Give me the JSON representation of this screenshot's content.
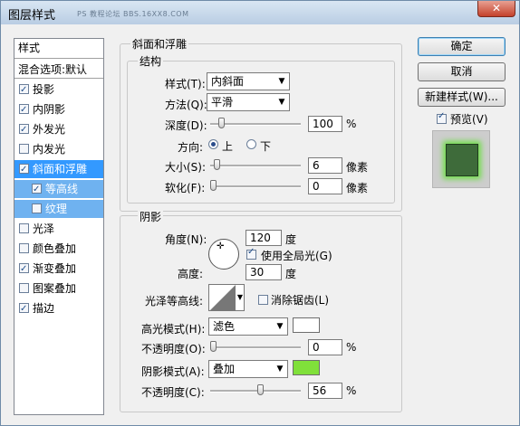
{
  "window": {
    "title": "图层样式",
    "watermark": "PS 教程论坛 BBS.16XX8.COM",
    "close_icon": "close-icon"
  },
  "styles_list": {
    "header": "样式",
    "blend_options": "混合选项:默认",
    "items": [
      {
        "label": "投影",
        "checked": true
      },
      {
        "label": "内阴影",
        "checked": true
      },
      {
        "label": "外发光",
        "checked": true
      },
      {
        "label": "内发光",
        "checked": false
      },
      {
        "label": "斜面和浮雕",
        "checked": true,
        "selected": true
      },
      {
        "label": "等高线",
        "checked": true,
        "sub": true
      },
      {
        "label": "纹理",
        "checked": false,
        "sub": true
      },
      {
        "label": "光泽",
        "checked": false
      },
      {
        "label": "颜色叠加",
        "checked": false
      },
      {
        "label": "渐变叠加",
        "checked": true
      },
      {
        "label": "图案叠加",
        "checked": false
      },
      {
        "label": "描边",
        "checked": true
      }
    ]
  },
  "bevel": {
    "section_title": "斜面和浮雕",
    "structure_title": "结构",
    "style_label": "样式(T):",
    "style_value": "内斜面",
    "technique_label": "方法(Q):",
    "technique_value": "平滑",
    "depth_label": "深度(D):",
    "depth_value": "100",
    "depth_unit": "%",
    "depth_level": 0.1,
    "direction_label": "方向:",
    "dir_up": "上",
    "dir_down": "下",
    "direction": "up",
    "size_label": "大小(S):",
    "size_value": "6",
    "size_unit": "像素",
    "size_level": 0.04,
    "soften_label": "软化(F):",
    "soften_value": "0",
    "soften_unit": "像素",
    "soften_level": 0
  },
  "shading": {
    "title": "阴影",
    "angle_label": "角度(N):",
    "angle_value": "120",
    "angle_unit": "度",
    "global_light": "使用全局光(G)",
    "global_light_checked": true,
    "altitude_label": "高度:",
    "altitude_value": "30",
    "altitude_unit": "度",
    "gloss_label": "光泽等高线:",
    "antialias": "消除锯齿(L)",
    "antialias_checked": false,
    "highlight_mode_label": "高光模式(H):",
    "highlight_mode": "滤色",
    "highlight_color": "#ffffff",
    "highlight_opacity_label": "不透明度(O):",
    "highlight_opacity": "0",
    "highlight_opacity_level": 0,
    "shadow_mode_label": "阴影模式(A):",
    "shadow_mode": "叠加",
    "shadow_color": "#80e03a",
    "shadow_opacity_label": "不透明度(C):",
    "shadow_opacity": "56",
    "shadow_opacity_level": 0.56,
    "percent": "%"
  },
  "buttons": {
    "ok": "确定",
    "cancel": "取消",
    "new_style": "新建样式(W)...",
    "preview": "预览(V)",
    "preview_checked": true
  }
}
